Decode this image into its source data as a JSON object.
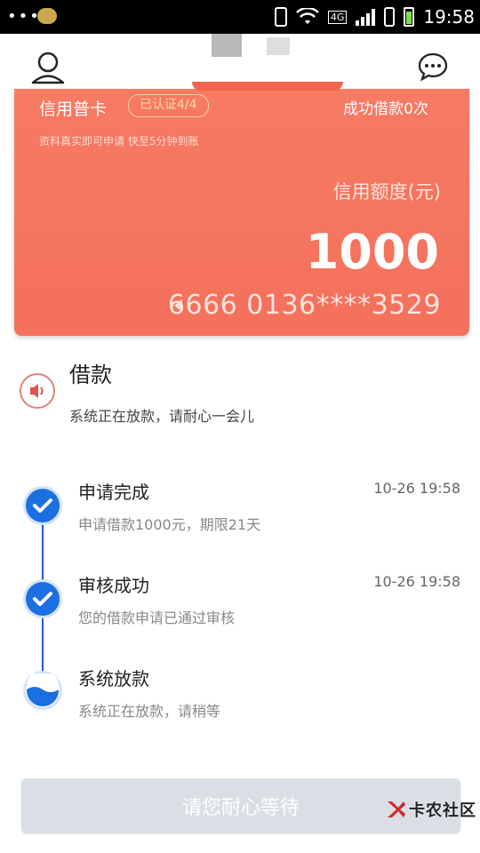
{
  "status_bar": {
    "time": "19:58",
    "network_label": "4G"
  },
  "card": {
    "type": "信用普卡",
    "badge": "已认证4/4",
    "success_count": "成功借款0次",
    "subtitle": "资料真实即可申请 快至5分钟到账",
    "limit_label": "信用额度(元)",
    "limit_amount": "1000",
    "card_number": "6666 0136****3529"
  },
  "loan": {
    "title": "借款",
    "description": "系统正在放款，请耐心一会儿"
  },
  "timeline": [
    {
      "title": "申请完成",
      "description": "申请借款1000元，期限21天",
      "time": "10-26 19:58",
      "state": "done"
    },
    {
      "title": "审核成功",
      "description": "您的借款申请已通过审核",
      "time": "10-26 19:58",
      "state": "done"
    },
    {
      "title": "系统放款",
      "description": "系统正在放款，请稍等",
      "time": "",
      "state": "in-progress"
    }
  ],
  "bottom_button": {
    "label": "请您耐心等待"
  },
  "watermark": {
    "text": "卡农社区"
  },
  "colors": {
    "card_bg": "#f4715c",
    "accent_blue": "#1b6fe1",
    "button_disabled": "#d9dfe5"
  }
}
